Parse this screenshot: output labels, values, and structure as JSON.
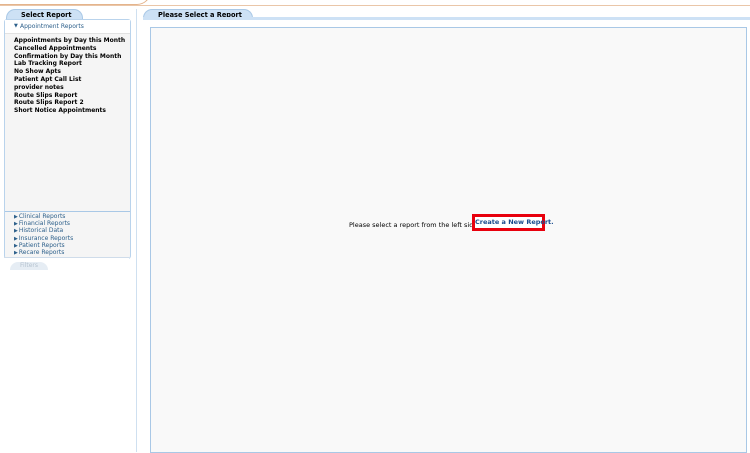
{
  "left_panel": {
    "tab_label": "Select Report",
    "active_category": "Appointment Reports",
    "reports": [
      "Appointments by Day this Month",
      "Cancelled Appointments",
      "Confirmation by Day this Month",
      "Lab Tracking Report",
      "No Show Apts",
      "Patient Apt Call List",
      "provider notes",
      "Route Slips Report",
      "Route Slips Report 2",
      "Short Notice Appointments"
    ],
    "categories": [
      "Clinical Reports",
      "Financial Reports",
      "Historical Data",
      "Insurance Reports",
      "Patient Reports",
      "Recare Reports"
    ],
    "filters_label": "Filters"
  },
  "right_panel": {
    "tab_label": "Please Select a Report",
    "message": "Please select a report from the left side or",
    "create_link": "Create a New Report."
  },
  "icons": {
    "expanded": "▼",
    "collapsed": "▶"
  },
  "colors": {
    "tab_bg": "#cde1f5",
    "link": "#2c5f8a",
    "highlight": "#e8000d"
  }
}
